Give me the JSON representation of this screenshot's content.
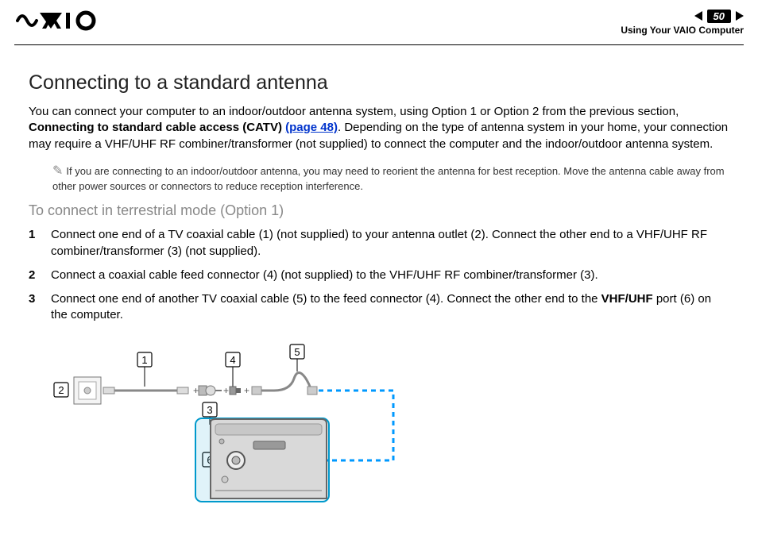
{
  "header": {
    "page_number": "50",
    "section": "Using Your VAIO Computer"
  },
  "title": "Connecting to a standard antenna",
  "intro": {
    "part1": "You can connect your computer to an indoor/outdoor antenna system, using Option 1 or Option 2 from the previous section, ",
    "bold": "Connecting to standard cable access (CATV) ",
    "link": "(page 48)",
    "part2": ". Depending on the type of antenna system in your home, your connection may require a VHF/UHF RF combiner/transformer (not supplied) to connect the computer and the indoor/outdoor antenna system."
  },
  "note": "If you are connecting to an indoor/outdoor antenna, you may need to reorient the antenna for best reception. Move the antenna cable away from other power sources or connectors to reduce reception interference.",
  "subtitle": "To connect in terrestrial mode (Option 1)",
  "steps": [
    {
      "pre": "Connect one end of a TV coaxial cable (1) (not supplied) to your antenna outlet (2). Connect the other end to a VHF/UHF RF combiner/transformer (3) (not supplied)."
    },
    {
      "pre": "Connect a coaxial cable feed connector (4) (not supplied) to the VHF/UHF RF combiner/transformer (3)."
    },
    {
      "pre": "Connect one end of another TV coaxial cable (5) to the feed connector (4). Connect the other end to the ",
      "bold": "VHF/UHF",
      "post": " port (6) on the computer."
    }
  ],
  "diagram_labels": {
    "l1": "1",
    "l2": "2",
    "l3": "3",
    "l4": "4",
    "l5": "5",
    "l6": "6"
  }
}
